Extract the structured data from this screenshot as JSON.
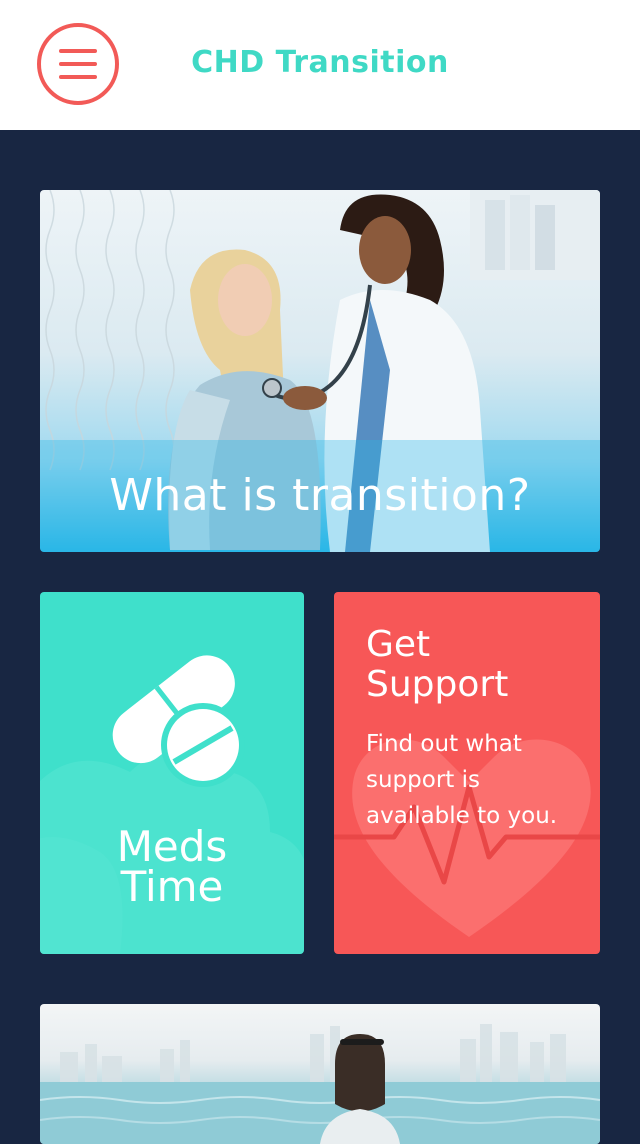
{
  "header": {
    "title": "CHD Transition",
    "menu_icon": "hamburger-menu-icon"
  },
  "cards": {
    "transition": {
      "title": "What is transition?",
      "image": "doctor-patient-photo"
    },
    "meds": {
      "line1": "Meds",
      "line2": "Time",
      "icon": "pills-icon"
    },
    "support": {
      "title_line1": "Get",
      "title_line2": "Support",
      "description": "Find out what support is available to you.",
      "background_icon": "heart-pulse-icon"
    },
    "beach": {
      "image": "person-by-sea-photo"
    }
  },
  "colors": {
    "navy_background": "#182642",
    "teal": "#3fd9c5",
    "coral": "#f25a57",
    "card_teal": "#3fe0cb",
    "card_coral": "#f75757"
  }
}
